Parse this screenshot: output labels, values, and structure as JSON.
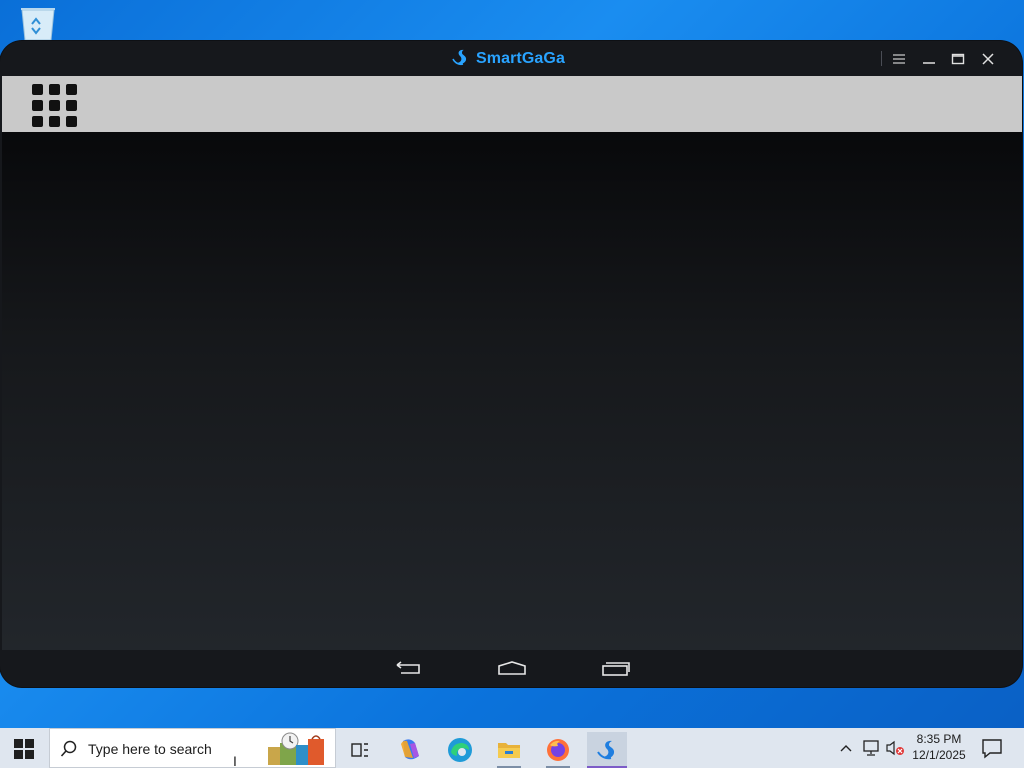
{
  "window": {
    "app_title": "SmartGaGa",
    "brand_color": "#29a3ff",
    "title_controls": [
      "menu-icon",
      "minimize-icon",
      "maximize-icon",
      "close-icon"
    ]
  },
  "screen": {
    "apps_button": "apps-grid-icon",
    "nav_buttons": [
      "back-icon",
      "home-icon",
      "recents-icon"
    ]
  },
  "desktop": {
    "icons": [
      "recycle-bin-icon"
    ]
  },
  "taskbar": {
    "search_placeholder": "Type here to search",
    "pinned": [
      "task-view-icon",
      "copilot-icon",
      "edge-icon",
      "file-explorer-icon",
      "firefox-icon",
      "smartgaga-icon"
    ],
    "active_app": "smartgaga-icon",
    "tray": [
      "show-hidden-icons-chevron",
      "network-icon",
      "volume-muted-icon"
    ],
    "clock": {
      "time": "8:35 PM",
      "date": "12/1/2025"
    }
  }
}
